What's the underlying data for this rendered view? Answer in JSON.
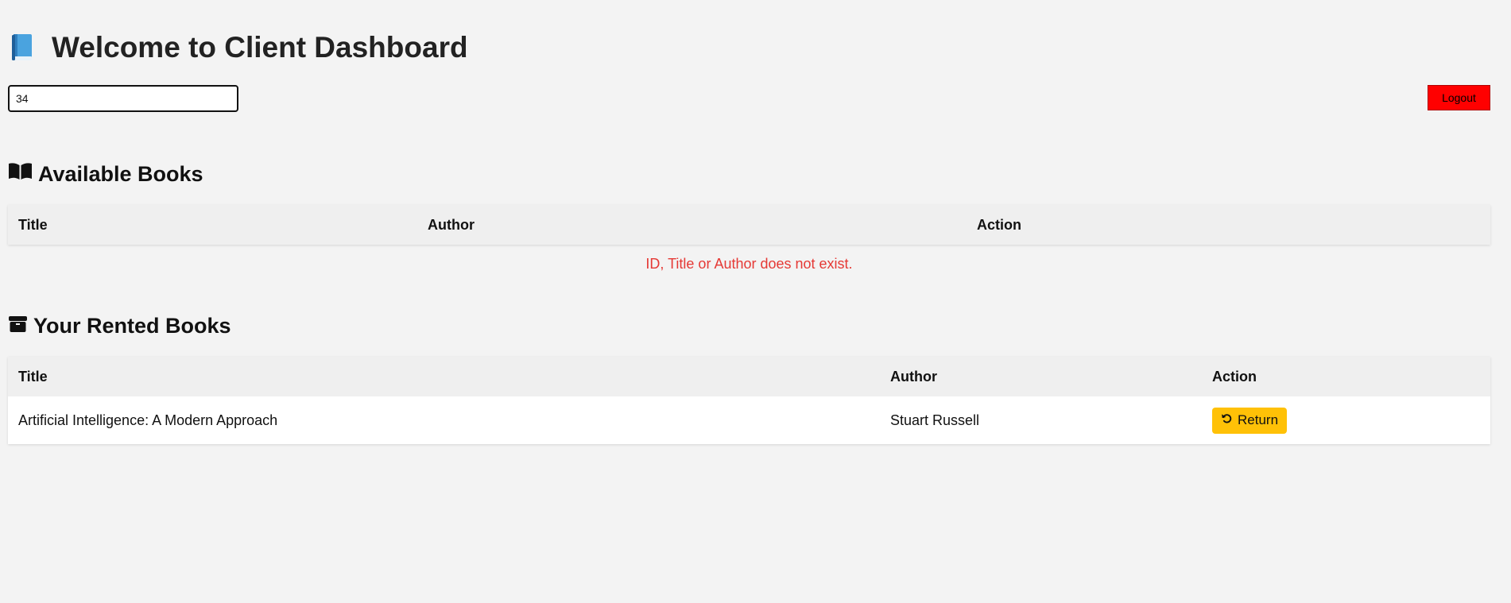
{
  "header": {
    "title": "Welcome to Client Dashboard"
  },
  "search": {
    "value": "34"
  },
  "actions": {
    "logout_label": "Logout"
  },
  "available": {
    "heading": "Available Books",
    "columns": [
      "Title",
      "Author",
      "Action"
    ],
    "empty_message": "ID, Title or Author does not exist."
  },
  "rented": {
    "heading": "Your Rented Books",
    "columns": [
      "Title",
      "Author",
      "Action"
    ],
    "rows": [
      {
        "title": "Artificial Intelligence: A Modern Approach",
        "author": "Stuart Russell",
        "action_label": "Return"
      }
    ]
  },
  "colors": {
    "background": "#f3f3f3",
    "logout": "#ff0000",
    "return": "#ffc107",
    "error_text": "#e53935"
  },
  "icons": {
    "title": "blue-book-icon",
    "available": "open-book-icon",
    "rented": "box-icon",
    "return": "undo-icon"
  }
}
